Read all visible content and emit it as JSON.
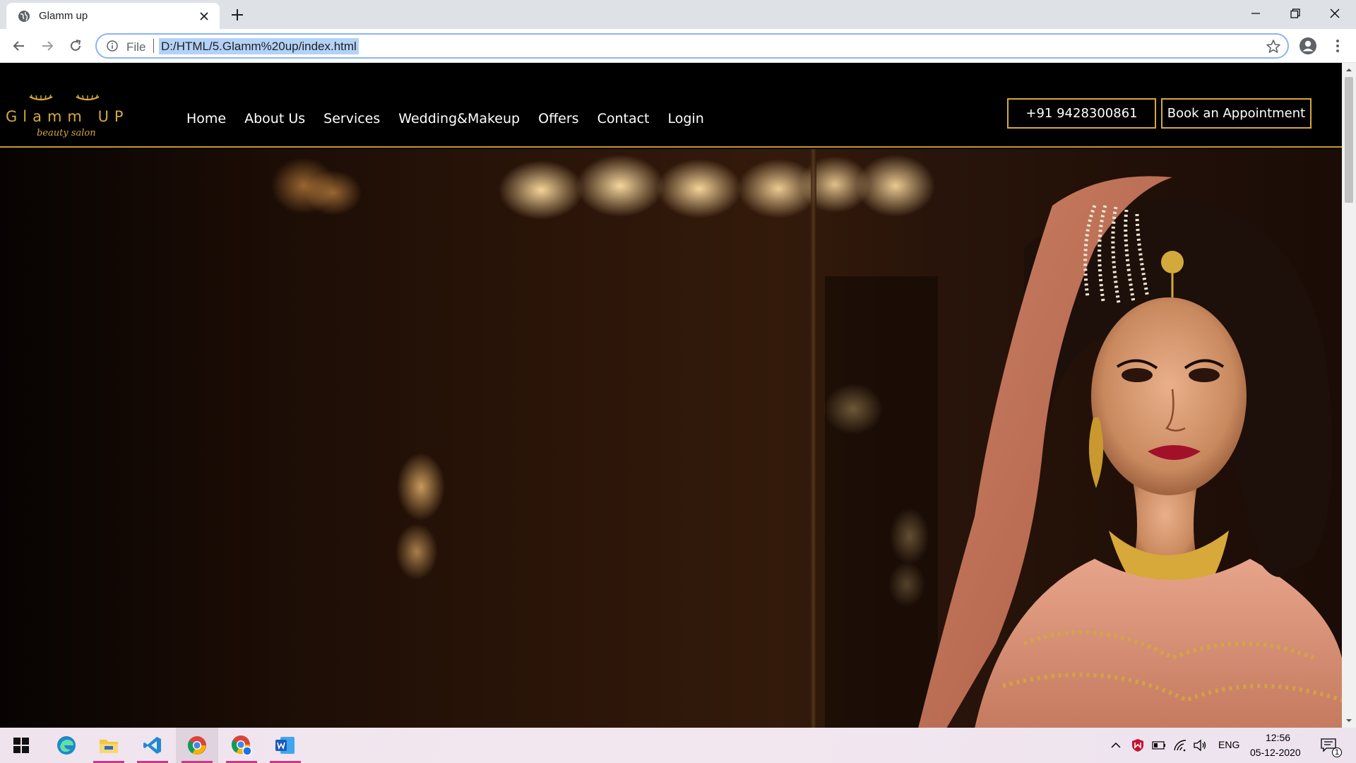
{
  "browser": {
    "tab_title": "Glamm up",
    "url_scheme": "File",
    "url": "D:/HTML/5.Glamm%20up/index.html"
  },
  "site": {
    "logo_name": "Glamm UP",
    "logo_tagline": "beauty salon",
    "nav": [
      {
        "label": "Home"
      },
      {
        "label": "About Us"
      },
      {
        "label": "Services"
      },
      {
        "label": "Wedding&Makeup"
      },
      {
        "label": "Offers"
      },
      {
        "label": "Contact"
      },
      {
        "label": "Login"
      }
    ],
    "phone_button": "+91 9428300861",
    "book_button": "Book an Appointment",
    "accent_color": "#d4a93c"
  },
  "taskbar": {
    "language": "ENG",
    "time": "12:56",
    "date": "05-12-2020",
    "notification_count": "1"
  }
}
